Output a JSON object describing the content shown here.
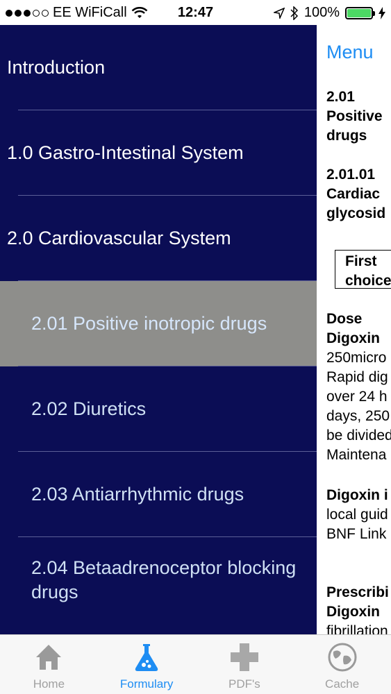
{
  "status": {
    "carrier": "EE WiFiCall",
    "time": "12:47",
    "battery": "100%",
    "battery_level": 1.0
  },
  "menu": {
    "items": [
      {
        "label": "Introduction",
        "level": "top"
      },
      {
        "label": "1.0 Gastro-Intestinal System",
        "level": "top"
      },
      {
        "label": "2.0 Cardiovascular System",
        "level": "top"
      },
      {
        "label": "2.01 Positive inotropic drugs",
        "level": "sub",
        "active": true
      },
      {
        "label": "2.02 Diuretics",
        "level": "sub"
      },
      {
        "label": "2.03 Antiarrhythmic drugs",
        "level": "sub"
      },
      {
        "label": "2.04 Betaadrenoceptor blocking\ndrugs",
        "level": "sub"
      }
    ]
  },
  "content": {
    "menu_link": "Menu",
    "heading1": "2.01\nPositive\ndrugs",
    "heading2": "2.01.01\nCardiac\nglycosid",
    "choice": "First\nchoice",
    "dose_title": "Dose",
    "dose_drug": "Digoxin",
    "dose_text": "250micro\nRapid dig\nover 24 h\ndays, 250\nbe divided\nMaintena",
    "digoxin_title": "Digoxin i",
    "digoxin_text": "local guid\nBNF Link",
    "prescribing_title": "Prescribi",
    "prescribing_drug": "Digoxin",
    "prescribing_text": "fibrillation"
  },
  "tabs": [
    {
      "label": "Home",
      "icon": "home-icon",
      "active": false
    },
    {
      "label": "Formulary",
      "icon": "flask-icon",
      "active": true
    },
    {
      "label": "PDF's",
      "icon": "medical-cross-icon",
      "active": false
    },
    {
      "label": "Cache",
      "icon": "globe-icon",
      "active": false
    }
  ],
  "colors": {
    "menu_bg": "#0b0d55",
    "active_bg": "#8e8e8b",
    "accent": "#1e8df3"
  }
}
